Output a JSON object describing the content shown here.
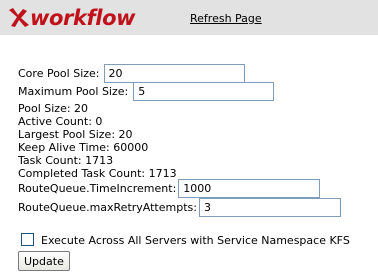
{
  "header": {
    "brand": "workflow",
    "refresh_link": "Refresh Page",
    "logo_color": "#c0121b",
    "background": "#e2e2e2"
  },
  "form": {
    "core_pool_size": {
      "label": "Core Pool Size:",
      "value": "20"
    },
    "maximum_pool_size": {
      "label": "Maximum Pool Size:",
      "value": "5"
    },
    "stats": [
      "Pool Size: 20",
      "Active Count: 0",
      "Largest Pool Size: 20",
      "Keep Alive Time: 60000",
      "Task Count: 1713",
      "Completed Task Count: 1713"
    ],
    "time_increment": {
      "label": "RouteQueue.TimeIncrement:",
      "value": "1000"
    },
    "max_retry_attempts": {
      "label": "RouteQueue.maxRetryAttempts:",
      "value": "3"
    },
    "execute_all_servers": {
      "label": "Execute Across All Servers with Service Namespace KFS",
      "checked": false
    },
    "update_button": "Update"
  }
}
